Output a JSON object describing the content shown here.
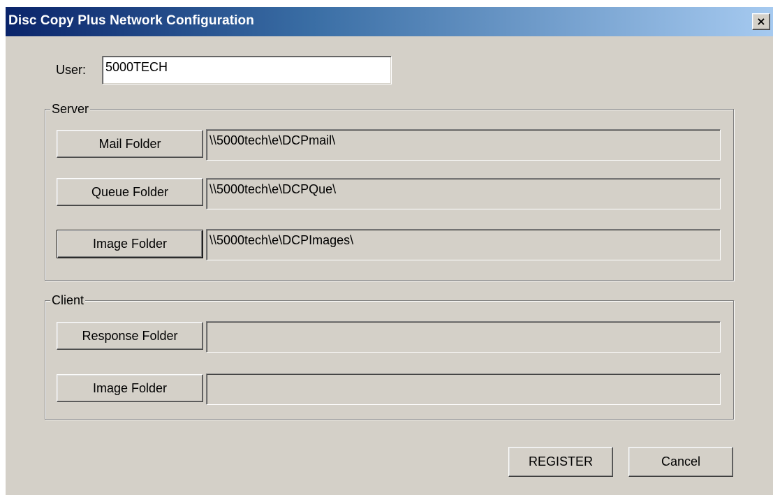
{
  "window": {
    "title": "Disc Copy Plus Network Configuration",
    "close_glyph": "×",
    "close_icon": "close-icon"
  },
  "user": {
    "label": "User:",
    "value": "5000TECH"
  },
  "server": {
    "caption": "Server",
    "rows": [
      {
        "button": "Mail Folder",
        "path": "\\\\5000tech\\e\\DCPmail\\"
      },
      {
        "button": "Queue Folder",
        "path": "\\\\5000tech\\e\\DCPQue\\"
      },
      {
        "button": "Image Folder",
        "path": "\\\\5000tech\\e\\DCPImages\\"
      }
    ]
  },
  "client": {
    "caption": "Client",
    "rows": [
      {
        "button": "Response Folder",
        "path": ""
      },
      {
        "button": "Image Folder",
        "path": ""
      }
    ]
  },
  "actions": {
    "register_label": "REGISTER",
    "cancel_label": "Cancel"
  },
  "colors": {
    "dialog_face": "#d4d0c8",
    "title_start": "#0a246a",
    "title_end": "#a6caf0"
  }
}
